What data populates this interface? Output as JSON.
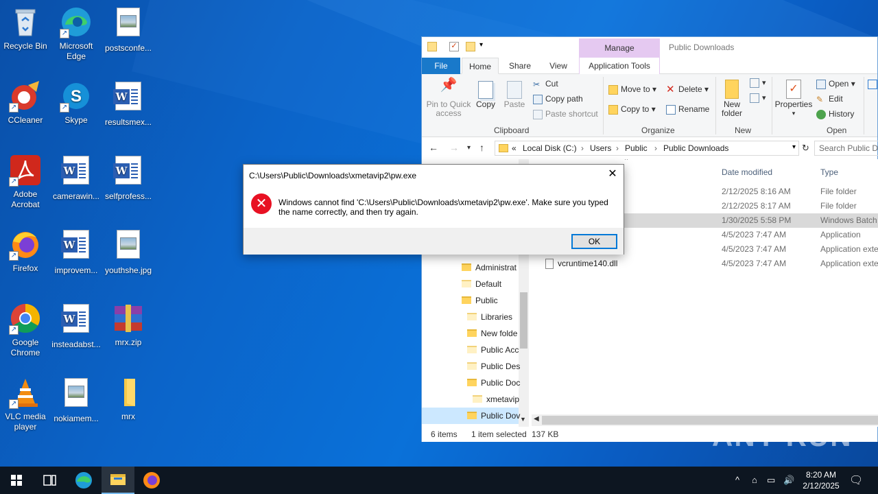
{
  "desktop": {
    "icons": [
      {
        "label": "Recycle Bin"
      },
      {
        "label": "Microsoft Edge"
      },
      {
        "label": "postsconfe..."
      },
      {
        "label": "CCleaner"
      },
      {
        "label": "Skype"
      },
      {
        "label": "resultsmex..."
      },
      {
        "label": "Adobe Acrobat"
      },
      {
        "label": "camerawin..."
      },
      {
        "label": "selfprofess..."
      },
      {
        "label": "Firefox"
      },
      {
        "label": "improvem..."
      },
      {
        "label": "youthshe.jpg"
      },
      {
        "label": "Google Chrome"
      },
      {
        "label": "insteadabst..."
      },
      {
        "label": "mrx.zip"
      },
      {
        "label": "VLC media player"
      },
      {
        "label": "nokiamem..."
      },
      {
        "label": "mrx"
      }
    ]
  },
  "explorer": {
    "title": "Public Downloads",
    "manage_tab": "Manage",
    "tabs": {
      "file": "File",
      "home": "Home",
      "share": "Share",
      "view": "View",
      "app_tools": "Application Tools"
    },
    "ribbon": {
      "pin": "Pin to Quick access",
      "copy": "Copy",
      "paste": "Paste",
      "cut": "Cut",
      "copy_path": "Copy path",
      "paste_shortcut": "Paste shortcut",
      "clipboard": "Clipboard",
      "move_to": "Move to",
      "copy_to": "Copy to",
      "delete": "Delete",
      "rename": "Rename",
      "organize": "Organize",
      "new_folder": "New folder",
      "new": "New",
      "properties": "Properties",
      "open": "Open",
      "edit": "Edit",
      "history": "History",
      "open_group": "Open"
    },
    "address": {
      "prefix": "«",
      "crumbs": [
        "Local Disk (C:)",
        "Users",
        "Public",
        "Public Downloads"
      ],
      "search_placeholder": "Search Public Downloads"
    },
    "nav": [
      {
        "label": "Administrat",
        "indent": 0
      },
      {
        "label": "Default",
        "indent": 0
      },
      {
        "label": "Public",
        "indent": 0
      },
      {
        "label": "Libraries",
        "indent": 1
      },
      {
        "label": "New folde",
        "indent": 1
      },
      {
        "label": "Public Acc",
        "indent": 1
      },
      {
        "label": "Public Des",
        "indent": 1
      },
      {
        "label": "Public Doc",
        "indent": 1
      },
      {
        "label": "xmetavip",
        "indent": 2
      },
      {
        "label": "Public Dov",
        "indent": 1
      }
    ],
    "columns": {
      "date": "Date modified",
      "type": "Type"
    },
    "files": [
      {
        "name": "",
        "date": "2/12/2025 8:16 AM",
        "type": "File folder"
      },
      {
        "name": "",
        "date": "2/12/2025 8:17 AM",
        "type": "File folder"
      },
      {
        "name": "",
        "date": "1/30/2025 5:58 PM",
        "type": "Windows Batch"
      },
      {
        "name": "",
        "date": "4/5/2023 7:47 AM",
        "type": "Application"
      },
      {
        "name": "",
        "date": "4/5/2023 7:47 AM",
        "type": "Application exte"
      },
      {
        "name": "vcruntime140.dll",
        "date": "4/5/2023 7:47 AM",
        "type": "Application exte"
      }
    ],
    "status": {
      "items": "6 items",
      "selected": "1 item selected",
      "size": "137 KB"
    }
  },
  "dialog": {
    "title": "C:\\Users\\Public\\Downloads\\xmetavip2\\pw.exe",
    "message": "Windows cannot find 'C:\\Users\\Public\\Downloads\\xmetavip2\\pw.exe'. Make sure you typed the name correctly, and then try again.",
    "ok": "OK"
  },
  "taskbar": {
    "time": "8:20 AM",
    "date": "2/12/2025"
  },
  "watermark": "ANY RUN",
  "colors": {
    "accent": "#0078d7",
    "file_tab": "#1979ca",
    "manage": "#e5c9f1",
    "error": "#e81123"
  }
}
